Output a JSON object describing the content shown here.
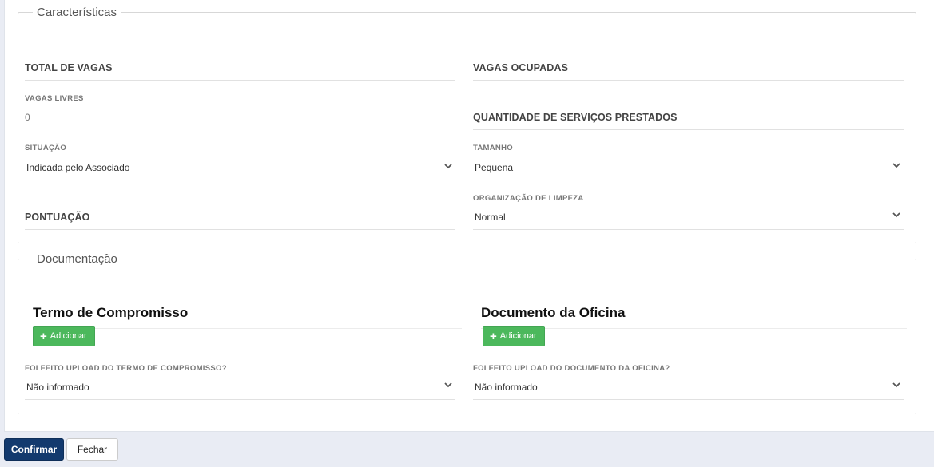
{
  "caracteristicas": {
    "legend": "Características",
    "total_vagas": {
      "label": "TOTAL DE VAGAS"
    },
    "vagas_ocupadas": {
      "label": "VAGAS OCUPADAS"
    },
    "vagas_livres": {
      "label": "VAGAS LIVRES",
      "value": "0"
    },
    "servicos_prestados": {
      "label": "QUANTIDADE DE SERVIÇOS PRESTADOS"
    },
    "situacao": {
      "label": "SITUAÇÃO",
      "value": "Indicada pelo Associado"
    },
    "tamanho": {
      "label": "TAMANHO",
      "value": "Pequena"
    },
    "organizacao_limpeza": {
      "label": "ORGANIZAÇÃO DE LIMPEZA",
      "value": "Normal"
    },
    "pontuacao": {
      "label": "PONTUAÇÃO"
    }
  },
  "documentacao": {
    "legend": "Documentação",
    "termo": {
      "title": "Termo de Compromisso",
      "add_label": "Adicionar",
      "upload_label": "FOI FEITO UPLOAD DO TERMO DE COMPROMISSO?",
      "upload_value": "Não informado"
    },
    "documento": {
      "title": "Documento da Oficina",
      "add_label": "Adicionar",
      "upload_label": "FOI FEITO UPLOAD DO DOCUMENTO DA OFICINA?",
      "upload_value": "Não informado"
    }
  },
  "footer": {
    "confirm_label": "Confirmar",
    "close_label": "Fechar"
  },
  "colors": {
    "confirm": "#133a6e",
    "add": "#4cb85c"
  }
}
